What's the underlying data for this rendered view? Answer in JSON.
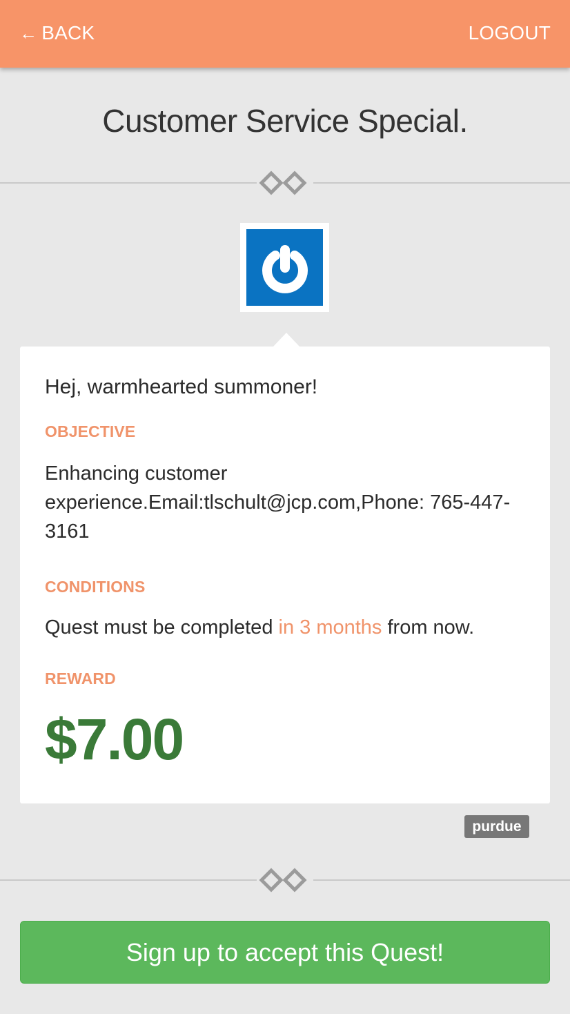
{
  "header": {
    "back_label": "BACK",
    "logout_label": "LOGOUT",
    "background_color": "#f79468"
  },
  "page": {
    "title": "Customer Service Special."
  },
  "logo": {
    "icon": "power-icon",
    "background_color": "#0a73c2"
  },
  "quest": {
    "greeting": "Hej, warmhearted summoner!",
    "objective_label": "OBJECTIVE",
    "objective_text": "Enhancing customer experience.Email:tlschult@jcp.com,Phone: 765-447-3161",
    "conditions_label": "CONDITIONS",
    "conditions_prefix": "Quest must be completed ",
    "conditions_highlight": "in 3 months",
    "conditions_suffix": " from now.",
    "reward_label": "REWARD",
    "reward_amount": "$7.00",
    "label_color": "#f0936a",
    "reward_color": "#3a7a38"
  },
  "tag": {
    "label": "purdue"
  },
  "cta": {
    "label": "Sign up to accept this Quest!",
    "color": "#5cb85c"
  }
}
